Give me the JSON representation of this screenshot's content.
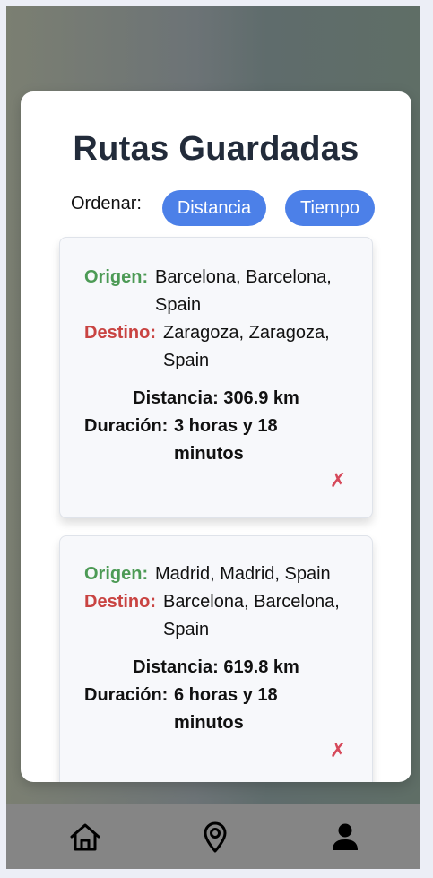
{
  "modal": {
    "title": "Rutas Guardadas",
    "sort_label": "Ordenar:",
    "sort_distance": "Distancia",
    "sort_time": "Tiempo"
  },
  "routes": [
    {
      "origin_label": "Origen:",
      "origin_line1": "Barcelona, Barcelona,",
      "origin_line2": "Spain",
      "dest_label": "Destino:",
      "dest_line1": "Zaragoza, Zaragoza,",
      "dest_line2": "Spain",
      "distance": "Distancia: 306.9 km",
      "duration_label": "Duración:",
      "duration_line1": "3 horas y 18",
      "duration_line2": "minutos",
      "delete_glyph": "✗"
    },
    {
      "origin_label": "Origen:",
      "origin_line1": "Madrid, Madrid, Spain",
      "dest_label": "Destino:",
      "dest_line1": "Barcelona, Barcelona,",
      "dest_line2": "Spain",
      "distance": "Distancia: 619.8 km",
      "duration_label": "Duración:",
      "duration_line1": "6 horas y 18",
      "duration_line2": "minutos",
      "delete_glyph": "✗"
    }
  ],
  "nav": {
    "icons": [
      "home-icon",
      "map-pin-icon",
      "user-icon"
    ],
    "active": "user-icon"
  },
  "colors": {
    "accent": "#4c80e8",
    "origin": "#4c9a55",
    "destination": "#c94442",
    "delete": "#d6495a",
    "title": "#222b3a",
    "nav_bar": "#858585"
  }
}
